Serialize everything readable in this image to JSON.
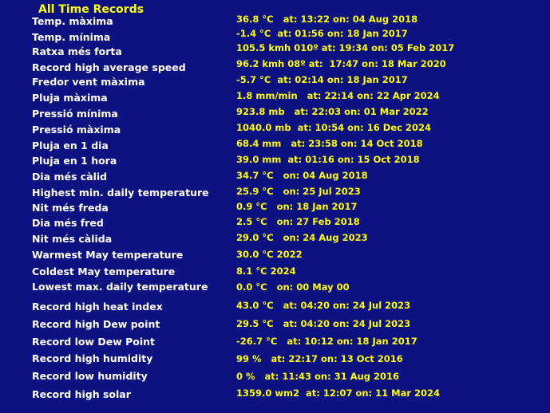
{
  "title": "All Time Records",
  "colors": {
    "background": "#0d1282",
    "title": "#ffff00",
    "label": "#ffffff",
    "value": "#ffff00"
  },
  "records": [
    {
      "label": "Temp. màxima",
      "value": "36.8 °C   at: 13:22 on: 04 Aug 2018"
    },
    {
      "label": "Temp. mínima",
      "value": "-1.4 °C  at: 01:56 on: 18 Jan 2017"
    },
    {
      "label": "Ratxa més forta",
      "value": "105.5 kmh 010º at: 19:34 on: 05 Feb 2017"
    },
    {
      "label": "Record high average speed",
      "value": "96.2 kmh 08º at:  17:47 on: 18 Mar 2020"
    },
    {
      "label": "Fredor vent màxima",
      "value": "-5.7 °C  at: 02:14 on: 18 Jan 2017"
    },
    {
      "label": "Pluja màxima",
      "value": "1.8 mm/min   at: 22:14 on: 22 Apr 2024"
    },
    {
      "label": "Pressió mínima",
      "value": "923.8 mb   at: 22:03 on: 01 Mar 2022"
    },
    {
      "label": "Pressió màxima",
      "value": "1040.0 mb  at: 10:54 on: 16 Dec 2024"
    },
    {
      "label": "Pluja en 1 dia",
      "value": "68.4 mm   at: 23:58 on: 14 Oct 2018"
    },
    {
      "label": "Pluja en 1 hora",
      "value": "39.0 mm  at: 01:16 on: 15 Oct 2018"
    },
    {
      "label": "Dia més càlid",
      "value": "34.7 °C   on: 04 Aug 2018"
    },
    {
      "label": "Highest min. daily temperature",
      "value": "25.9 °C   on: 25 Jul 2023"
    },
    {
      "label": "Nit més freda",
      "value": "0.9 °C   on: 18 Jan 2017"
    },
    {
      "label": "Dia més fred",
      "value": "2.5 °C   on: 27 Feb 2018"
    },
    {
      "label": "Nit més càlida",
      "value": "29.0 °C   on: 24 Aug 2023"
    },
    {
      "label": "Warmest May temperature",
      "value": "30.0 °C 2022"
    },
    {
      "label": "Coldest May temperature",
      "value": "8.1 °C 2024"
    },
    {
      "label": "Lowest max. daily temperature",
      "value": "0.0 °C   on: 00 May 00"
    },
    {
      "label": "Record high heat index",
      "value": "43.0 °C   at: 04:20 on: 24 Jul 2023"
    },
    {
      "label": "Record high Dew point",
      "value": "29.5 °C   at: 04:20 on: 24 Jul 2023"
    },
    {
      "label": "Record low Dew Point",
      "value": "-26.7 °C   at: 10:12 on: 18 Jan 2017"
    },
    {
      "label": "Record high humidity",
      "value": "99 %   at: 22:17 on: 13 Oct 2016"
    },
    {
      "label": "Record low humidity",
      "value": "0 %   at: 11:43 on: 31 Aug 2016"
    },
    {
      "label": "Record high solar",
      "value": "1359.0 wm2  at: 12:07 on: 11 Mar 2024"
    }
  ]
}
